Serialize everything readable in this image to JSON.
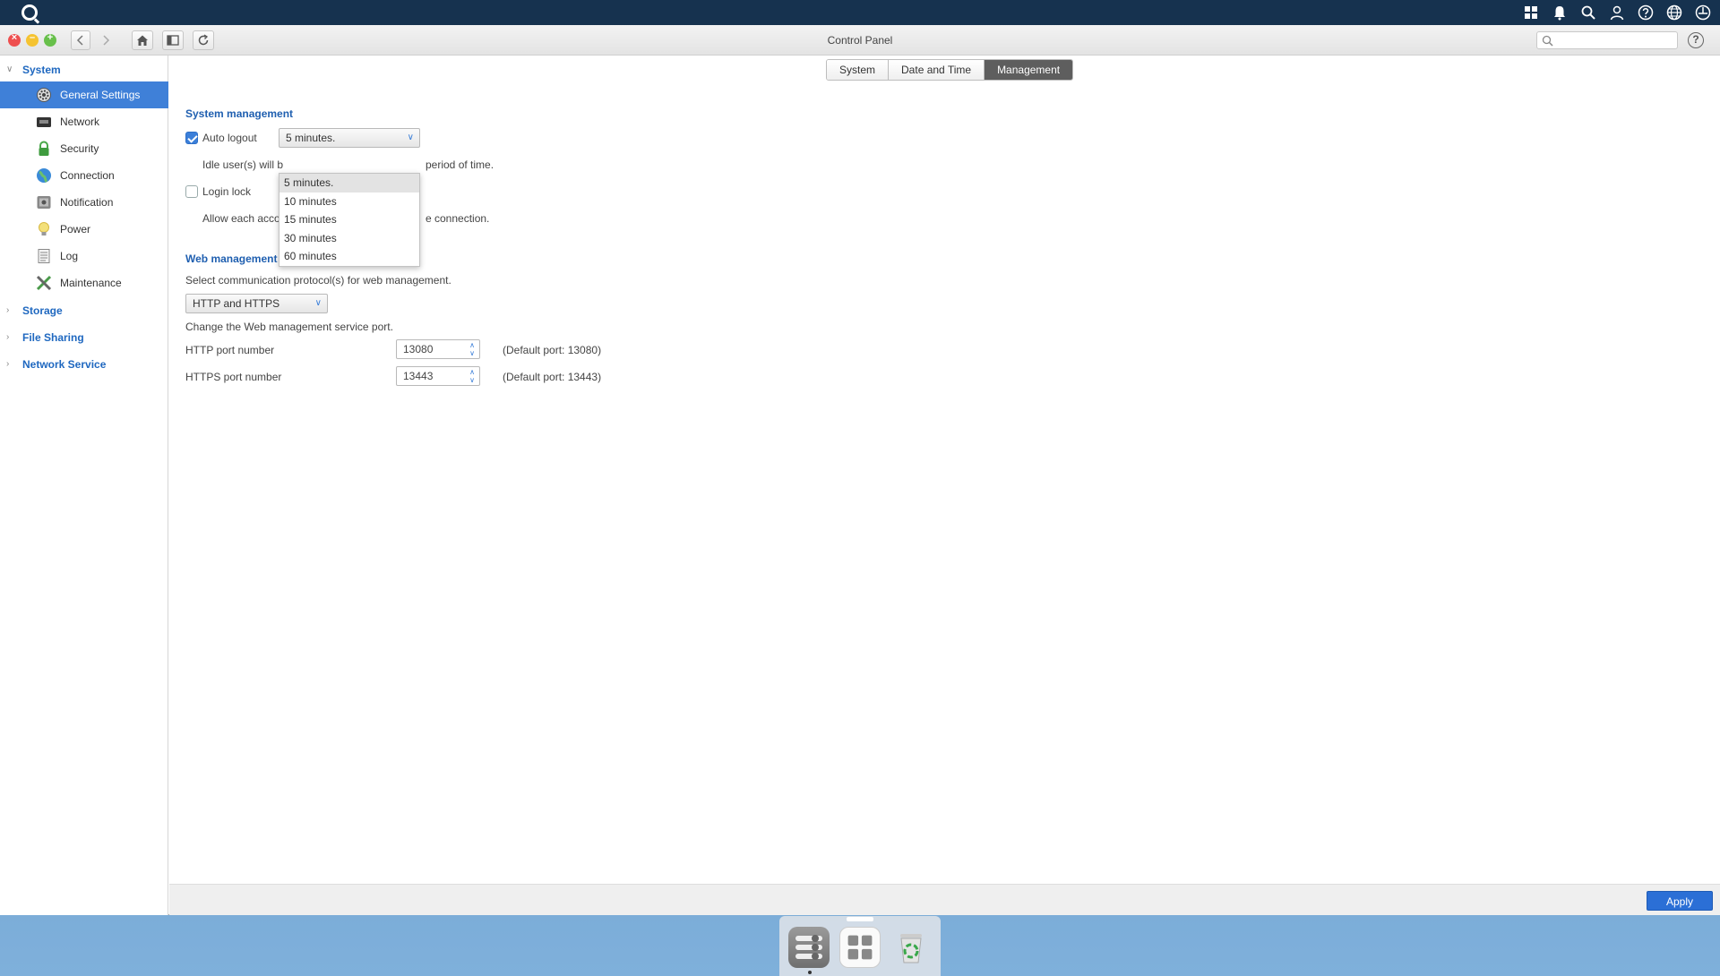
{
  "window": {
    "title": "Control Panel",
    "search_placeholder": "",
    "help_label": "?"
  },
  "sidebar": {
    "groups": [
      {
        "label": "System",
        "expanded": true
      },
      {
        "label": "Storage",
        "expanded": false
      },
      {
        "label": "File Sharing",
        "expanded": false
      },
      {
        "label": "Network Service",
        "expanded": false
      }
    ],
    "items": [
      {
        "label": "General Settings",
        "icon": "gear-icon",
        "active": true
      },
      {
        "label": "Network",
        "icon": "network-icon"
      },
      {
        "label": "Security",
        "icon": "lock-icon"
      },
      {
        "label": "Connection",
        "icon": "globe-icon"
      },
      {
        "label": "Notification",
        "icon": "notification-icon"
      },
      {
        "label": "Power",
        "icon": "bulb-icon"
      },
      {
        "label": "Log",
        "icon": "log-icon"
      },
      {
        "label": "Maintenance",
        "icon": "tools-icon"
      }
    ]
  },
  "tabs": [
    {
      "label": "System"
    },
    {
      "label": "Date and Time"
    },
    {
      "label": "Management",
      "active": true
    }
  ],
  "system_management": {
    "title": "System management",
    "auto_logout": {
      "label": "Auto logout",
      "checked": true,
      "value": "5 minutes."
    },
    "auto_logout_desc_left": "Idle user(s) will b",
    "auto_logout_desc_right": "period of time.",
    "login_lock": {
      "label": "Login lock",
      "checked": false
    },
    "login_lock_desc_left": "Allow each accou",
    "login_lock_desc_right": "e connection.",
    "dropdown_options": [
      "5 minutes.",
      "10 minutes",
      "15 minutes",
      "30 minutes",
      "60 minutes"
    ]
  },
  "web_management": {
    "title": "Web management service",
    "protocol_desc": "Select communication protocol(s) for web management.",
    "protocol_value": "HTTP and HTTPS",
    "port_desc": "Change the Web management service port.",
    "http_label": "HTTP port number",
    "http_value": "13080",
    "http_default": "(Default port: 13080)",
    "https_label": "HTTPS port number",
    "https_value": "13443",
    "https_default": "(Default port: 13443)"
  },
  "footer": {
    "apply_label": "Apply"
  },
  "colors": {
    "accent": "#3f80d8",
    "link": "#1f68c0",
    "apply": "#2b6fd6"
  }
}
